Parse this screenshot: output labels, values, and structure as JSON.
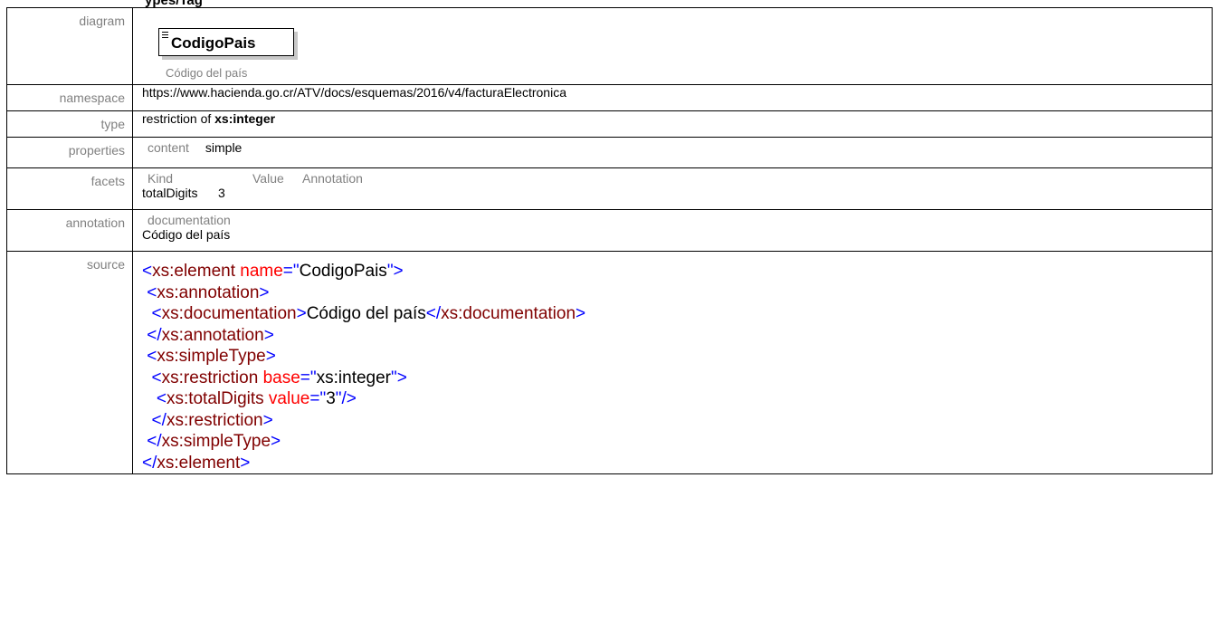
{
  "heading": "ypes/Tag",
  "rows": {
    "diagram": {
      "label": "diagram",
      "element_name": "CodigoPais",
      "element_doc": "Código del país"
    },
    "namespace": {
      "label": "namespace",
      "value": "https://www.hacienda.go.cr/ATV/docs/esquemas/2016/v4/facturaElectronica"
    },
    "type": {
      "label": "type",
      "prefix": "restriction of ",
      "base": "xs:integer"
    },
    "properties": {
      "label": "properties",
      "key": "content",
      "value": "simple"
    },
    "facets": {
      "label": "facets",
      "headers": [
        "Kind",
        "Value",
        "Annotation"
      ],
      "kind": "totalDigits",
      "value": "3"
    },
    "annotation": {
      "label": "annotation",
      "key": "documentation",
      "value": "Código del país"
    },
    "source": {
      "label": "source",
      "lines": [
        [
          {
            "t": "tag",
            "s": "<"
          },
          {
            "t": "name",
            "s": "xs:element"
          },
          {
            "t": "tag",
            "s": " "
          },
          {
            "t": "attr",
            "s": "name"
          },
          {
            "t": "tag",
            "s": "=\""
          },
          {
            "t": "text",
            "s": "CodigoPais"
          },
          {
            "t": "tag",
            "s": "\">"
          }
        ],
        [
          {
            "t": "tag",
            "s": " <"
          },
          {
            "t": "name",
            "s": "xs:annotation"
          },
          {
            "t": "tag",
            "s": ">"
          }
        ],
        [
          {
            "t": "tag",
            "s": "  <"
          },
          {
            "t": "name",
            "s": "xs:documentation"
          },
          {
            "t": "tag",
            "s": ">"
          },
          {
            "t": "text",
            "s": "Código del país"
          },
          {
            "t": "tag",
            "s": "</"
          },
          {
            "t": "name",
            "s": "xs:documentation"
          },
          {
            "t": "tag",
            "s": ">"
          }
        ],
        [
          {
            "t": "tag",
            "s": " </"
          },
          {
            "t": "name",
            "s": "xs:annotation"
          },
          {
            "t": "tag",
            "s": ">"
          }
        ],
        [
          {
            "t": "tag",
            "s": " <"
          },
          {
            "t": "name",
            "s": "xs:simpleType"
          },
          {
            "t": "tag",
            "s": ">"
          }
        ],
        [
          {
            "t": "tag",
            "s": "  <"
          },
          {
            "t": "name",
            "s": "xs:restriction"
          },
          {
            "t": "tag",
            "s": " "
          },
          {
            "t": "attr",
            "s": "base"
          },
          {
            "t": "tag",
            "s": "=\""
          },
          {
            "t": "text",
            "s": "xs:integer"
          },
          {
            "t": "tag",
            "s": "\">"
          }
        ],
        [
          {
            "t": "tag",
            "s": "   <"
          },
          {
            "t": "name",
            "s": "xs:totalDigits"
          },
          {
            "t": "tag",
            "s": " "
          },
          {
            "t": "attr",
            "s": "value"
          },
          {
            "t": "tag",
            "s": "=\""
          },
          {
            "t": "text",
            "s": "3"
          },
          {
            "t": "tag",
            "s": "\"/>"
          }
        ],
        [
          {
            "t": "tag",
            "s": "  </"
          },
          {
            "t": "name",
            "s": "xs:restriction"
          },
          {
            "t": "tag",
            "s": ">"
          }
        ],
        [
          {
            "t": "tag",
            "s": " </"
          },
          {
            "t": "name",
            "s": "xs:simpleType"
          },
          {
            "t": "tag",
            "s": ">"
          }
        ],
        [
          {
            "t": "tag",
            "s": "</"
          },
          {
            "t": "name",
            "s": "xs:element"
          },
          {
            "t": "tag",
            "s": ">"
          }
        ]
      ]
    }
  },
  "colors": {
    "tag": "#0000ff",
    "name": "#800000",
    "attr": "#ff0000",
    "text": "#000000",
    "label": "#808080"
  }
}
